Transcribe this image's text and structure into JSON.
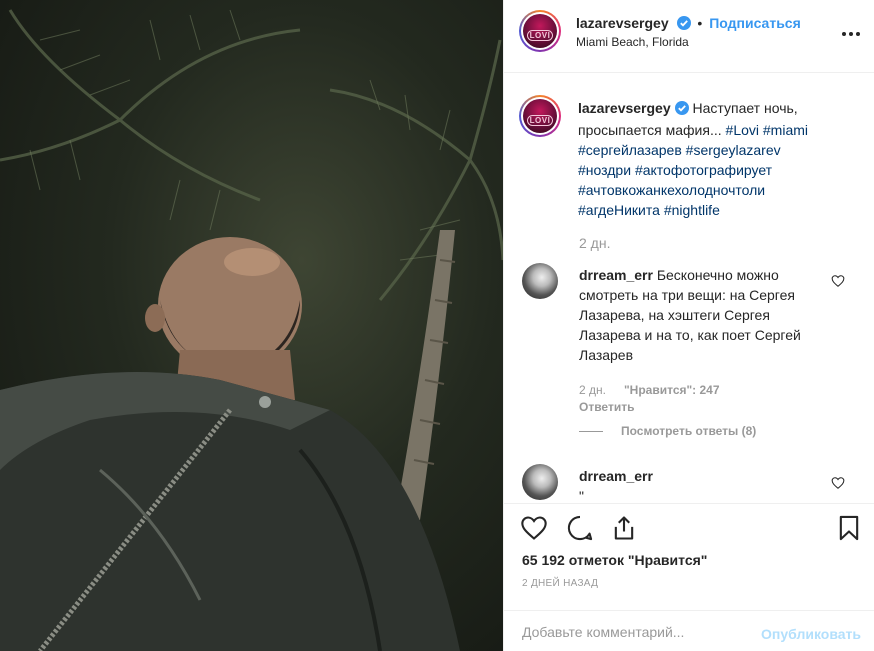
{
  "header": {
    "username": "lazarevsergey",
    "separator": "•",
    "follow_label": "Подписаться",
    "location": "Miami Beach, Florida",
    "avatar_text": "LOVI"
  },
  "caption": {
    "username": "lazarevsergey",
    "text_before": " Наступает ночь, просыпается мафия... ",
    "tags": [
      "#Lovi",
      "#miami",
      "#сергейлазарев",
      "#sergeylazarev",
      "#ноздри",
      "#актофотографирует",
      "#ачтовкожанкехолодночтоли",
      "#агдеНикита",
      "#nightlife"
    ],
    "time": "2 дн."
  },
  "comments": [
    {
      "username": "drream_err",
      "text": " Бесконечно можно смотреть на три вещи: на Сергея Лазарева, на хэштеги Сергея Лазарева и на то, как поет Сергей Лазарев",
      "time": "2 дн.",
      "likes": "\"Нравится\": 247",
      "reply_label": "Ответить",
      "view_replies": "Посмотреть ответы (8)"
    },
    {
      "username": "drream_err",
      "text": "\""
    }
  ],
  "actions": {
    "likes_count": "65 192 отметок \"Нравится\"",
    "posted": "2 ДНЕЙ НАЗАД"
  },
  "add_comment": {
    "placeholder": "Добавьте комментарий...",
    "publish_label": "Опубликовать"
  },
  "colors": {
    "link_blue": "#3897f0",
    "hashtag": "#003569",
    "muted": "#999999",
    "publish_disabled": "#b2dffc"
  },
  "icons": [
    "verified-badge-icon",
    "more-options-icon",
    "heart-icon",
    "comment-icon",
    "share-icon",
    "bookmark-icon"
  ]
}
